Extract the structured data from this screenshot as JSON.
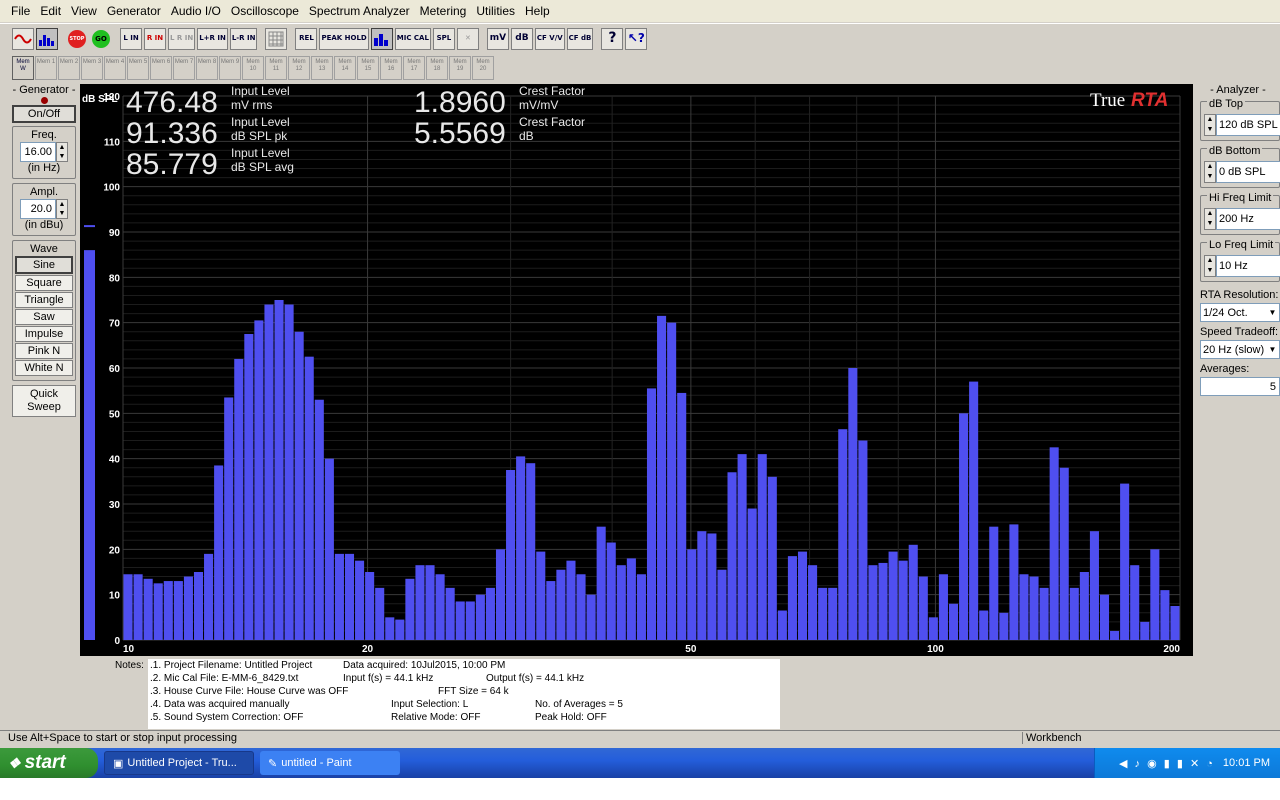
{
  "menu": [
    "File",
    "Edit",
    "View",
    "Generator",
    "Audio I/O",
    "Oscilloscope",
    "Spectrum Analyzer",
    "Metering",
    "Utilities",
    "Help"
  ],
  "toolbar": {
    "stop_label": "STOP",
    "go_label": "GO",
    "l_in": "L IN",
    "r_in": "R IN",
    "lr_in": "L R IN",
    "lpr_in": "L+R IN",
    "lmr_in": "L-R IN",
    "rel": "REL",
    "peak_hold": "PEAK HOLD",
    "mic_cal": "MIC CAL",
    "spl": "SPL",
    "mv": "mV",
    "db": "dB",
    "cf_vv": "CF V/V",
    "cf_db": "CF dB"
  },
  "memory": {
    "first": "Mem W",
    "slots": [
      "1",
      "2",
      "3",
      "4",
      "5",
      "6",
      "7",
      "8",
      "9",
      "10",
      "11",
      "12",
      "13",
      "14",
      "15",
      "16",
      "17",
      "18",
      "19",
      "20"
    ],
    "slot_prefix": "Mem"
  },
  "generator": {
    "title": "- Generator -",
    "onoff": "On/Off",
    "freq_label": "Freq.",
    "freq_value": "16.00",
    "freq_unit": "(in Hz)",
    "ampl_label": "Ampl.",
    "ampl_value": "20.0",
    "ampl_unit": "(in dBu)",
    "wave_label": "Wave",
    "waves": [
      "Sine",
      "Square",
      "Triangle",
      "Saw",
      "Impulse",
      "Pink N",
      "White N"
    ],
    "selected_wave": "Sine",
    "quick_sweep": "Quick Sweep"
  },
  "readouts": {
    "input_mv": {
      "value": "476.48",
      "l1": "Input Level",
      "l2": "mV rms"
    },
    "input_pk": {
      "value": "91.336",
      "l1": "Input Level",
      "l2": "dB SPL pk"
    },
    "input_avg": {
      "value": "85.779",
      "l1": "Input Level",
      "l2": "dB SPL avg"
    },
    "crest_vv": {
      "value": "1.8960",
      "l1": "Crest Factor",
      "l2": "mV/mV"
    },
    "crest_db": {
      "value": "5.5569",
      "l1": "Crest Factor",
      "l2": "dB"
    }
  },
  "logo": {
    "part1": "True",
    "part2": "RTA"
  },
  "analyzer": {
    "title": "- Analyzer -",
    "db_top_label": "dB Top",
    "db_top_value": "120 dB SPL",
    "db_bottom_label": "dB Bottom",
    "db_bottom_value": "0 dB SPL",
    "hi_freq_label": "Hi Freq Limit",
    "hi_freq_value": "200 Hz",
    "lo_freq_label": "Lo Freq Limit",
    "lo_freq_value": "10 Hz",
    "resolution_label": "RTA Resolution:",
    "resolution_value": "1/24 Oct.",
    "speed_label": "Speed Tradeoff:",
    "speed_value": "20 Hz (slow)",
    "averages_label": "Averages:",
    "averages_value": "5"
  },
  "notes": {
    "label": "Notes:",
    "lines": [
      ".1. Project Filename: Untitled Project",
      ".2. Mic Cal File: E-MM-6_8429.txt",
      ".3. House Curve File: House Curve was OFF",
      ".4. Data was acquired manually",
      ".5. Sound System Correction: OFF"
    ],
    "col2": [
      "Data acquired: 10Jul2015, 10:00 PM",
      "Input f(s) = 44.1 kHz",
      "FFT Size = 64 k",
      "Input Selection: L",
      "Relative Mode:  OFF"
    ],
    "col3": [
      "",
      "Output f(s) = 44.1 kHz",
      "",
      "No. of Averages = 5",
      "Peak Hold: OFF"
    ]
  },
  "status": {
    "hint": "Use Alt+Space to start or stop input processing",
    "panel": "Workbench"
  },
  "taskbar": {
    "start": "start",
    "tasks": [
      "Untitled Project - Tru...",
      "untitled - Paint"
    ],
    "clock": "10:01 PM"
  },
  "chart_data": {
    "type": "bar",
    "xscale": "log",
    "xlim": [
      10,
      200
    ],
    "ylim": [
      0,
      120
    ],
    "ylabel": "dB SPL",
    "yticks": [
      0,
      10,
      20,
      30,
      40,
      50,
      60,
      70,
      80,
      90,
      100,
      110,
      120
    ],
    "xticks": [
      10,
      20,
      50,
      100,
      200
    ],
    "bar_color": "#4f4ff0",
    "level_meter": {
      "value": 86,
      "peak": 91.3
    },
    "bars": [
      14.5,
      14.5,
      13.5,
      12.5,
      13,
      13,
      14,
      15,
      19,
      38.5,
      53.5,
      62,
      67.5,
      70.5,
      74,
      75,
      74,
      68,
      62.5,
      53,
      40,
      19,
      19,
      17.5,
      15,
      11.5,
      5,
      4.5,
      13.5,
      16.5,
      16.5,
      14.5,
      11.5,
      8.5,
      8.5,
      10,
      11.5,
      20,
      37.5,
      40.5,
      39,
      19.5,
      13,
      15.5,
      17.5,
      14.5,
      10,
      25,
      21.5,
      16.5,
      18,
      14.5,
      55.5,
      71.5,
      70,
      54.5,
      20,
      24,
      23.5,
      15.5,
      37,
      41,
      29,
      41,
      36,
      6.5,
      18.5,
      19.5,
      16.5,
      11.5,
      11.5,
      46.5,
      60,
      44,
      16.5,
      17,
      19.5,
      17.5,
      21,
      14,
      5,
      14.5,
      8,
      50,
      57,
      6.5,
      25,
      6,
      25.5,
      14.5,
      14,
      11.5,
      42.5,
      38,
      11.5,
      15,
      24,
      10,
      2,
      34.5,
      16.5,
      4,
      20,
      11,
      7.5
    ]
  }
}
